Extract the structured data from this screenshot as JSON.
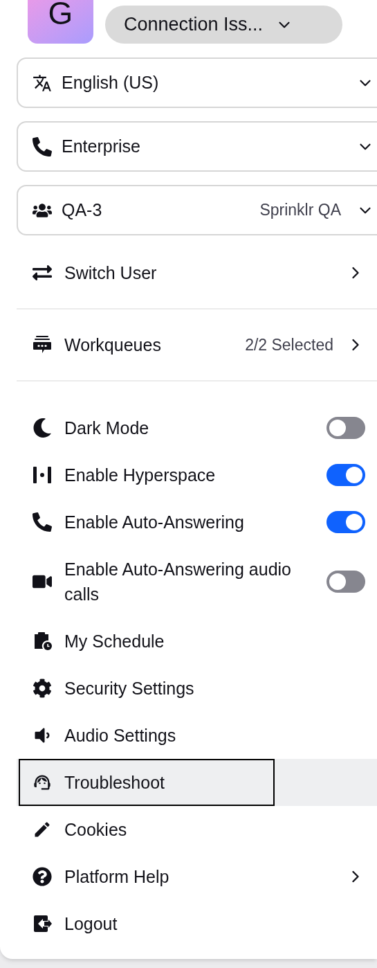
{
  "header": {
    "avatar_letter": "G",
    "status": "Connection Iss..."
  },
  "dropdowns": [
    {
      "label": "English (US)"
    },
    {
      "label": "Enterprise"
    },
    {
      "label": "QA-3",
      "value": "Sprinklr QA"
    }
  ],
  "sections": [
    {
      "items": [
        {
          "kind": "nav",
          "label": "Switch User",
          "highlighted": false
        }
      ]
    },
    {
      "items": [
        {
          "kind": "nav",
          "label": "Workqueues",
          "value": "2/2 Selected",
          "highlighted": false
        }
      ]
    },
    {
      "items": [
        {
          "kind": "toggle",
          "label": "Dark Mode",
          "on": false,
          "highlighted": false
        },
        {
          "kind": "toggle",
          "label": "Enable Hyperspace",
          "on": true,
          "highlighted": false
        },
        {
          "kind": "toggle",
          "label": "Enable Auto-Answering",
          "on": true,
          "highlighted": false
        },
        {
          "kind": "toggle",
          "label": "Enable Auto-Answering audio calls",
          "on": false,
          "highlighted": false
        },
        {
          "kind": "action",
          "label": "My Schedule",
          "highlighted": false
        },
        {
          "kind": "action",
          "label": "Security Settings",
          "highlighted": false
        },
        {
          "kind": "action",
          "label": "Audio Settings",
          "highlighted": false
        },
        {
          "kind": "action",
          "label": "Troubleshoot",
          "highlighted": true
        },
        {
          "kind": "action",
          "label": "Cookies",
          "highlighted": false
        },
        {
          "kind": "nav",
          "label": "Platform Help",
          "highlighted": false
        },
        {
          "kind": "action",
          "label": "Logout",
          "highlighted": false
        }
      ]
    }
  ]
}
